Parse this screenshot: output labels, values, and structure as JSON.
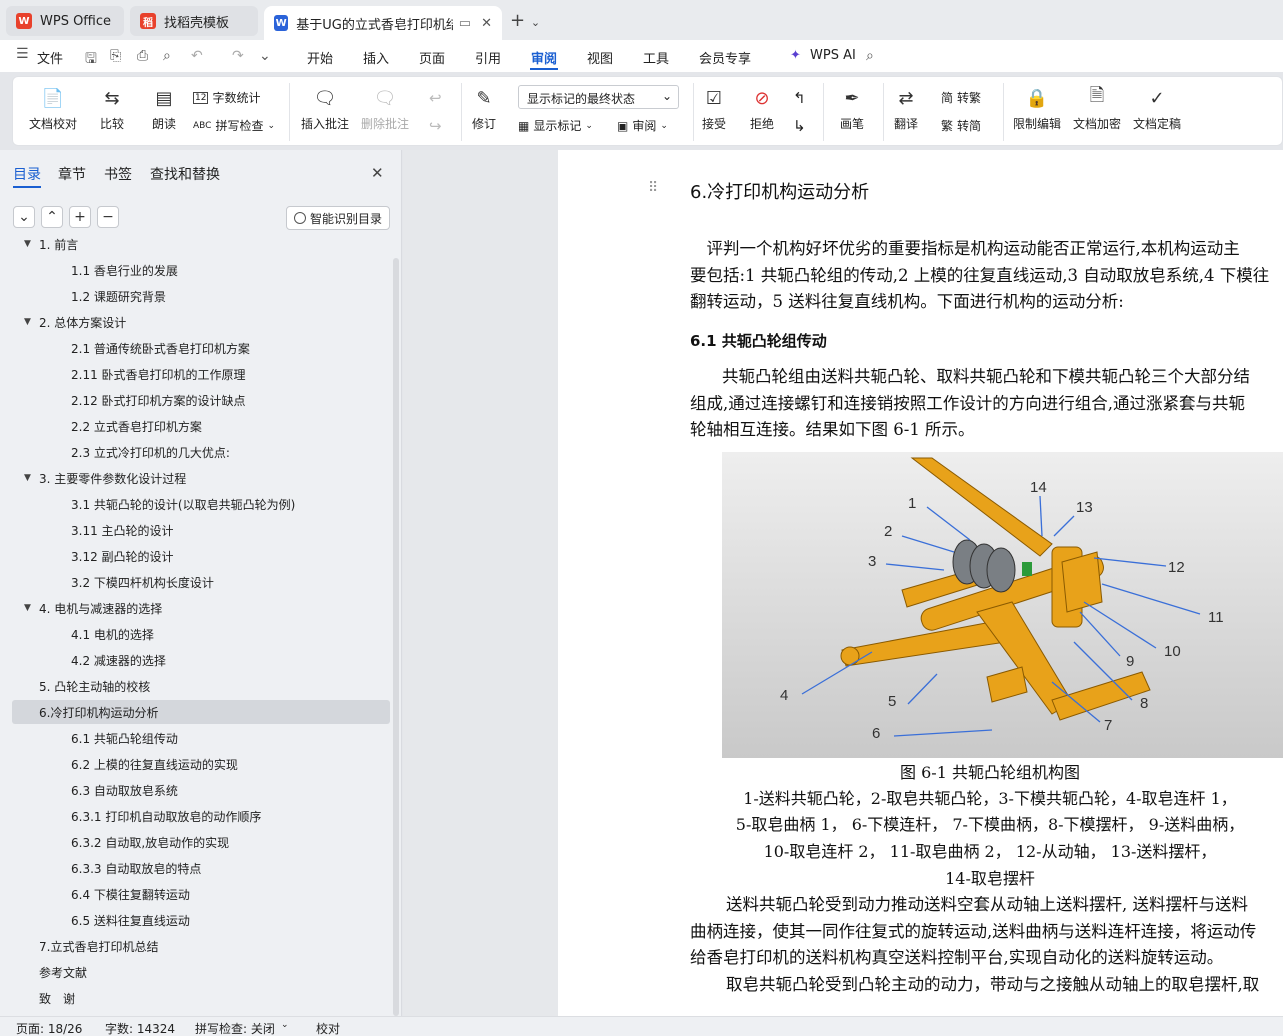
{
  "tabs": [
    {
      "label": "WPS Office"
    },
    {
      "label": "找稻壳模板"
    },
    {
      "label": "基于UG的立式香皂打印机结构"
    }
  ],
  "menu": {
    "file": "文件",
    "items": [
      "开始",
      "插入",
      "页面",
      "引用",
      "审阅",
      "视图",
      "工具",
      "会员专享"
    ],
    "active": "审阅",
    "ai": "WPS AI"
  },
  "ribbon": {
    "doc_check": "文档校对",
    "compare": "比较",
    "read_aloud": "朗读",
    "word_count": "字数统计",
    "spell_check": "拼写检查",
    "insert_comment": "插入批注",
    "delete_comment": "删除批注",
    "track": "修订",
    "display_mode": "显示标记的最终状态",
    "show_markup": "显示标记",
    "review": "审阅",
    "accept": "接受",
    "reject": "拒绝",
    "pen": "画笔",
    "translate": "翻译",
    "to_trad": "转繁",
    "to_simp": "转简",
    "restrict": "限制编辑",
    "encrypt": "文档加密",
    "finalize": "文档定稿"
  },
  "sidebar": {
    "tabs": [
      "目录",
      "章节",
      "书签",
      "查找和替换"
    ],
    "smart_toc": "智能识别目录",
    "toc": [
      {
        "label": "1. 前言",
        "level": 1,
        "expanded": true
      },
      {
        "label": "1.1 香皂行业的发展",
        "level": 2
      },
      {
        "label": "1.2 课题研究背景",
        "level": 2
      },
      {
        "label": "2. 总体方案设计",
        "level": 1,
        "expanded": true
      },
      {
        "label": "2.1 普通传统卧式香皂打印机方案",
        "level": 2
      },
      {
        "label": "2.11 卧式香皂打印机的工作原理",
        "level": 2
      },
      {
        "label": "2.12 卧式打印机方案的设计缺点",
        "level": 2
      },
      {
        "label": "2.2 立式香皂打印机方案",
        "level": 2
      },
      {
        "label": "2.3 立式冷打印机的几大优点:",
        "level": 2
      },
      {
        "label": "3. 主要零件参数化设计过程",
        "level": 1,
        "expanded": true
      },
      {
        "label": "3.1 共轭凸轮的设计(以取皂共轭凸轮为例)",
        "level": 2
      },
      {
        "label": "3.11 主凸轮的设计",
        "level": 2
      },
      {
        "label": "3.12 副凸轮的设计",
        "level": 2
      },
      {
        "label": "3.2 下模四杆机构长度设计",
        "level": 2
      },
      {
        "label": "4. 电机与减速器的选择",
        "level": 1,
        "expanded": true
      },
      {
        "label": "4.1 电机的选择",
        "level": 2
      },
      {
        "label": "4.2 减速器的选择",
        "level": 2
      },
      {
        "label": "5. 凸轮主动轴的校核",
        "level": 1
      },
      {
        "label": "6.冷打印机构运动分析",
        "level": 1,
        "selected": true
      },
      {
        "label": "6.1 共轭凸轮组传动",
        "level": 2
      },
      {
        "label": "6.2 上模的往复直线运动的实现",
        "level": 2
      },
      {
        "label": "6.3 自动取放皂系统",
        "level": 2
      },
      {
        "label": "6.3.1 打印机自动取放皂的动作顺序",
        "level": 2
      },
      {
        "label": "6.3.2 自动取,放皂动作的实现",
        "level": 2
      },
      {
        "label": "6.3.3 自动取放皂的特点",
        "level": 2
      },
      {
        "label": "6.4 下模往复翻转运动",
        "level": 2
      },
      {
        "label": "6.5 送料往复直线运动",
        "level": 2
      },
      {
        "label": "7.立式香皂打印机总结",
        "level": 1
      },
      {
        "label": "参考文献",
        "level": 1
      },
      {
        "label": "致　谢",
        "level": 1
      }
    ]
  },
  "doc": {
    "heading": "6.冷打印机构运动分析",
    "p1": [
      "　评判一个机构好坏优劣的重要指标是机构运动能否正常运行,本机构运动主",
      "要包括:1 共轭凸轮组的传动,2 上模的往复直线运动,3 自动取放皂系统,4 下模往",
      "翻转运动，5 送料往复直线机构。下面进行机构的运动分析:"
    ],
    "h2": "6.1 共轭凸轮组传动",
    "p2": [
      "共轭凸轮组由送料共轭凸轮、取料共轭凸轮和下模共轭凸轮三个大部分结",
      "组成,通过连接螺钉和连接销按照工作设计的方向进行组合,通过涨紧套与共轭",
      "轮轴相互连接。结果如下图 6-1 所示。"
    ],
    "figure_labels": [
      "1",
      "2",
      "3",
      "4",
      "5",
      "6",
      "7",
      "8",
      "9",
      "10",
      "11",
      "12",
      "13",
      "14"
    ],
    "caption_title": "图 6-1  共轭凸轮组机构图",
    "caption_lines": [
      "1-送料共轭凸轮，2-取皂共轭凸轮，3-下模共轭凸轮，4-取皂连杆 1，",
      "5-取皂曲柄 1，  6-下模连杆，  7-下模曲柄，8-下模摆杆，  9-送料曲柄，",
      "10-取皂连杆 2，  11-取皂曲柄 2，  12-从动轴，  13-送料摆杆，",
      "14-取皂摆杆"
    ],
    "p3": [
      "送料共轭凸轮受到动力推动送料空套从动轴上送料摆杆, 送料摆杆与送料",
      "曲柄连接，使其一同作往复式的旋转运动,送料曲柄与送料连杆连接，将运动传",
      "给香皂打印机的送料机构真空送料控制平台,实现自动化的送料旋转运动。",
      "取皂共轭凸轮受到凸轮主动的动力，带动与之接触从动轴上的取皂摆杆,取"
    ]
  },
  "status": {
    "page": "页面: 18/26",
    "words": "字数: 14324",
    "spell": "拼写检查: 关闭",
    "proof": "校对"
  }
}
